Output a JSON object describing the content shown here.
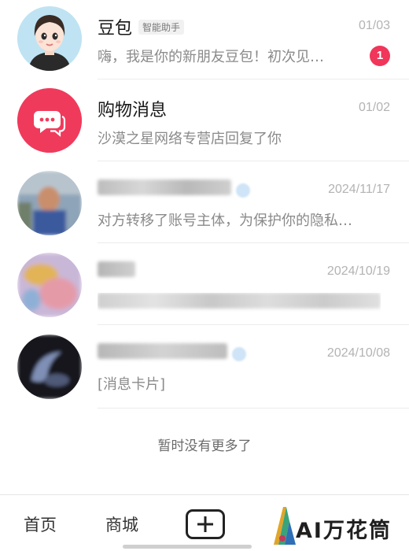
{
  "conversations": [
    {
      "name": "豆包",
      "tag": "智能助手",
      "date": "01/03",
      "preview": "嗨，我是你的新朋友豆包！初次见…",
      "unread": "1"
    },
    {
      "name": "购物消息",
      "date": "01/02",
      "preview": "沙漠之星网络专营店回复了你"
    },
    {
      "date": "2024/11/17",
      "preview": "对方转移了账号主体，为保护你的隐私…"
    },
    {
      "date": "2024/10/19"
    },
    {
      "date": "2024/10/08",
      "preview": "[消息卡片]"
    }
  ],
  "end_note": "暂时没有更多了",
  "tabbar": {
    "home": "首页",
    "mall": "商城"
  },
  "watermark": "AI万花筒",
  "colors": {
    "badge": "#f0365a",
    "shopping_icon": "#f03a5c"
  }
}
